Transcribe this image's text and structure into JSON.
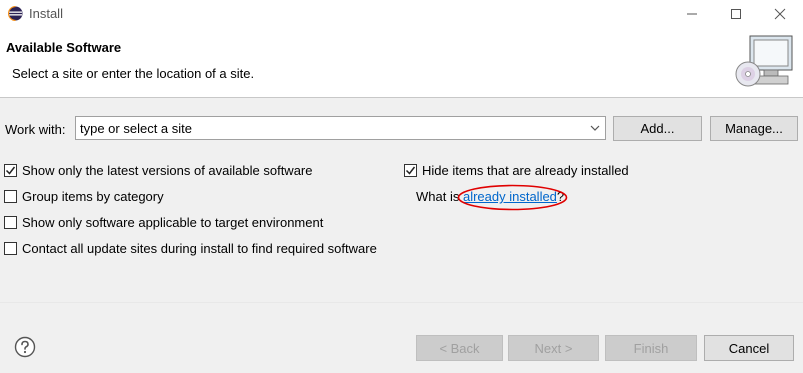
{
  "window": {
    "title": "Install",
    "icon": "eclipse-icon"
  },
  "banner": {
    "title": "Available Software",
    "description": "Select a site or enter the location of a site.",
    "image": "install-wizard-image"
  },
  "work_with": {
    "label": "Work with:",
    "value": "type or select a site",
    "add_label": "Add...",
    "manage_label": "Manage..."
  },
  "options": {
    "latest_versions": {
      "label": "Show only the latest versions of available software",
      "checked": true
    },
    "group_by_category": {
      "label": "Group items by category",
      "checked": false
    },
    "target_env": {
      "label": "Show only software applicable to target environment",
      "checked": false
    },
    "contact_sites": {
      "label": "Contact all update sites during install to find required software",
      "checked": false
    },
    "hide_installed": {
      "label": "Hide items that are already installed",
      "checked": true
    }
  },
  "what_is": {
    "prefix": "What is ",
    "link": "already installed",
    "suffix": "?"
  },
  "footer": {
    "back_label": "< Back",
    "next_label": "Next >",
    "finish_label": "Finish",
    "cancel_label": "Cancel"
  },
  "colors": {
    "link": "#0066cc",
    "highlight_ellipse": "#e00000"
  }
}
